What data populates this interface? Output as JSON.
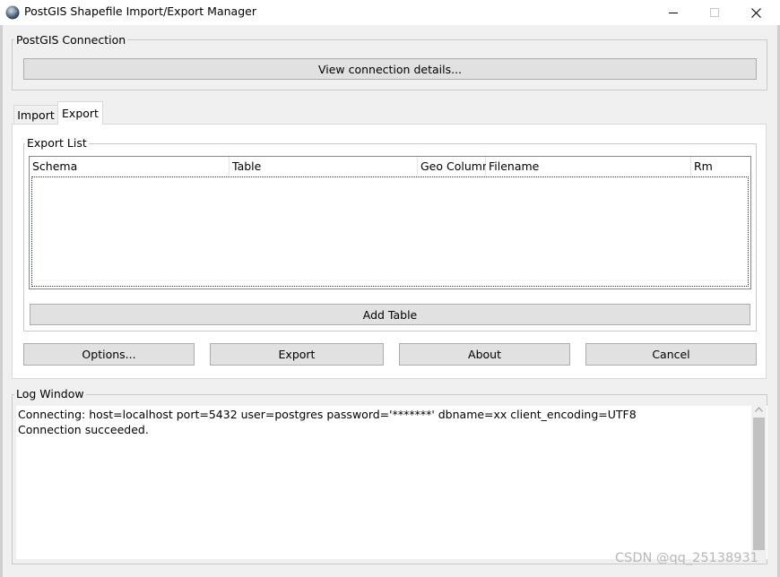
{
  "window": {
    "title": "PostGIS Shapefile Import/Export Manager"
  },
  "connection": {
    "group_label": "PostGIS Connection",
    "view_details_label": "View connection details..."
  },
  "tabs": [
    {
      "label": "Import",
      "active": false
    },
    {
      "label": "Export",
      "active": true
    }
  ],
  "export_list": {
    "group_label": "Export List",
    "columns": [
      "Schema",
      "Table",
      "Geo Column",
      "Filename",
      "Rm"
    ],
    "rows": [],
    "add_table_label": "Add Table"
  },
  "actions": {
    "options_label": "Options...",
    "export_label": "Export",
    "about_label": "About",
    "cancel_label": "Cancel"
  },
  "log": {
    "group_label": "Log Window",
    "lines": [
      "Connecting:  host=localhost port=5432 user=postgres password='*******' dbname=xx client_encoding=UTF8",
      "Connection succeeded."
    ]
  },
  "watermark": "CSDN @qq_25138931",
  "icons": {
    "app": "globe-icon",
    "minimize": "minimize-icon",
    "maximize": "maximize-icon",
    "close": "close-icon",
    "scroll_up": "chevron-up-icon"
  }
}
